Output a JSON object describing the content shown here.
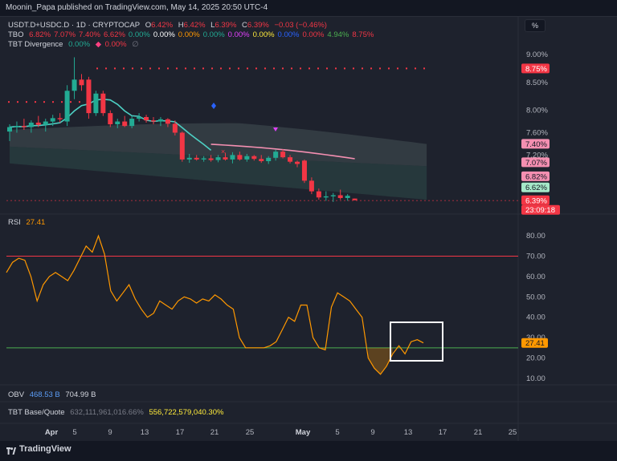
{
  "header": {
    "publisher_line": "Moonin_Papa published on TradingView.com, May 14, 2025 20:50 UTC-4"
  },
  "legend_main": {
    "symbol": "USDT.D+USDC.D · 1D · CRYPTOCAP",
    "o_label": "O",
    "o_value": "6.42%",
    "h_label": "H",
    "h_value": "6.42%",
    "l_label": "L",
    "l_value": "6.39%",
    "c_label": "C",
    "c_value": "6.39%",
    "change": "−0.03 (−0.46%)"
  },
  "legend_tbo": {
    "name": "TBO",
    "values": [
      "6.82%",
      "7.07%",
      "7.40%",
      "6.62%",
      "0.00%",
      "0.00%",
      "0.00%",
      "0.00%",
      "0.00%",
      "0.00%",
      "0.00%",
      "0.00%",
      "4.94%",
      "8.75%"
    ],
    "colors": [
      "#f23645",
      "#f23645",
      "#f23645",
      "#f23645",
      "#22ab94",
      "#ffffff",
      "#ff9800",
      "#22ab94",
      "#e040fb",
      "#ffeb3b",
      "#2962ff",
      "#f23645",
      "#4caf50",
      "#f23645"
    ]
  },
  "legend_div": {
    "name": "TBT Divergence",
    "v1": "0.00%",
    "v2": "0.00%",
    "v3": "∅"
  },
  "pct_button": "%",
  "rsi_legend": {
    "name": "RSI",
    "value": "27.41"
  },
  "obv_legend": {
    "name": "OBV",
    "v1": "468.53 B",
    "v2": "704.99 B"
  },
  "tbt_legend": {
    "name": "TBT Base/Quote",
    "v1": "632,111,961,016.66%",
    "v2": "556,722,579,040.30%"
  },
  "footer": {
    "brand": "TradingView"
  },
  "colors": {
    "up": "#22ab94",
    "down": "#f23645",
    "rsi": "#ff9800",
    "ma_fast": "#4dd0c4",
    "ma_slow": "#f48fb1",
    "overbought": "#f23645",
    "oversold": "#4caf50"
  },
  "chart_data": [
    {
      "type": "candlestick",
      "title": "USDT.D+USDC.D · 1D · CRYPTOCAP",
      "x_ticks": [
        "Apr",
        "5",
        "9",
        "13",
        "17",
        "21",
        "25",
        "May",
        "5",
        "9",
        "13",
        "17",
        "21",
        "25"
      ],
      "y_ticks": [
        "9.00%",
        "8.50%",
        "8.00%",
        "7.60%",
        "7.20%",
        "6.80%"
      ],
      "ylim": [
        6.2,
        9.1
      ],
      "price_labels": [
        {
          "text": "8.75%",
          "value": 8.75,
          "color": "#f23645"
        },
        {
          "text": "7.40%",
          "value": 7.4,
          "color": "#f48fb1"
        },
        {
          "text": "7.07%",
          "value": 7.07,
          "color": "#f48fb1"
        },
        {
          "text": "6.82%",
          "value": 6.82,
          "color": "#f48fb1"
        },
        {
          "text": "6.62%",
          "value": 6.62,
          "color": "#a5e8c8"
        },
        {
          "text": "6.39%",
          "value": 6.39,
          "color": "#f23645"
        }
      ],
      "countdown": "23:09:18",
      "candles": [
        {
          "o": 7.62,
          "h": 7.75,
          "l": 7.45,
          "c": 7.7
        },
        {
          "o": 7.7,
          "h": 7.8,
          "l": 7.6,
          "c": 7.72
        },
        {
          "o": 7.72,
          "h": 7.85,
          "l": 7.65,
          "c": 7.7
        },
        {
          "o": 7.7,
          "h": 7.82,
          "l": 7.6,
          "c": 7.78
        },
        {
          "o": 7.78,
          "h": 7.9,
          "l": 7.7,
          "c": 7.74
        },
        {
          "o": 7.74,
          "h": 7.85,
          "l": 7.62,
          "c": 7.8
        },
        {
          "o": 7.8,
          "h": 7.92,
          "l": 7.72,
          "c": 7.86
        },
        {
          "o": 7.86,
          "h": 7.95,
          "l": 7.78,
          "c": 7.84
        },
        {
          "o": 7.8,
          "h": 8.45,
          "l": 7.72,
          "c": 8.35
        },
        {
          "o": 8.35,
          "h": 8.95,
          "l": 8.2,
          "c": 8.55
        },
        {
          "o": 8.55,
          "h": 8.65,
          "l": 8.35,
          "c": 8.45
        },
        {
          "o": 8.55,
          "h": 8.6,
          "l": 7.85,
          "c": 7.95
        },
        {
          "o": 7.95,
          "h": 8.35,
          "l": 7.9,
          "c": 8.3
        },
        {
          "o": 8.3,
          "h": 8.35,
          "l": 7.9,
          "c": 7.95
        },
        {
          "o": 7.95,
          "h": 8.0,
          "l": 7.7,
          "c": 7.75
        },
        {
          "o": 7.75,
          "h": 7.85,
          "l": 7.68,
          "c": 7.8
        },
        {
          "o": 7.8,
          "h": 7.9,
          "l": 7.7,
          "c": 7.72
        },
        {
          "o": 7.72,
          "h": 7.9,
          "l": 7.68,
          "c": 7.85
        },
        {
          "o": 7.85,
          "h": 7.95,
          "l": 7.8,
          "c": 7.88
        },
        {
          "o": 7.88,
          "h": 7.92,
          "l": 7.78,
          "c": 7.82
        },
        {
          "o": 7.82,
          "h": 7.88,
          "l": 7.75,
          "c": 7.8
        },
        {
          "o": 7.8,
          "h": 7.88,
          "l": 7.72,
          "c": 7.84
        },
        {
          "o": 7.84,
          "h": 7.86,
          "l": 7.7,
          "c": 7.76
        },
        {
          "o": 7.76,
          "h": 7.82,
          "l": 7.55,
          "c": 7.6
        },
        {
          "o": 7.6,
          "h": 7.62,
          "l": 7.08,
          "c": 7.12
        },
        {
          "o": 7.12,
          "h": 7.22,
          "l": 7.06,
          "c": 7.15
        },
        {
          "o": 7.15,
          "h": 7.2,
          "l": 7.1,
          "c": 7.12
        },
        {
          "o": 7.12,
          "h": 7.18,
          "l": 7.08,
          "c": 7.14
        },
        {
          "o": 7.14,
          "h": 7.2,
          "l": 7.08,
          "c": 7.11
        },
        {
          "o": 7.11,
          "h": 7.2,
          "l": 7.07,
          "c": 7.16
        },
        {
          "o": 7.16,
          "h": 7.24,
          "l": 7.1,
          "c": 7.12
        },
        {
          "o": 7.12,
          "h": 7.25,
          "l": 7.05,
          "c": 7.2
        },
        {
          "o": 7.2,
          "h": 7.26,
          "l": 7.1,
          "c": 7.12
        },
        {
          "o": 7.12,
          "h": 7.22,
          "l": 7.08,
          "c": 7.18
        },
        {
          "o": 7.18,
          "h": 7.2,
          "l": 7.1,
          "c": 7.13
        },
        {
          "o": 7.13,
          "h": 7.2,
          "l": 7.06,
          "c": 7.09
        },
        {
          "o": 7.09,
          "h": 7.18,
          "l": 7.04,
          "c": 7.15
        },
        {
          "o": 7.15,
          "h": 7.3,
          "l": 7.1,
          "c": 7.26
        },
        {
          "o": 7.26,
          "h": 7.3,
          "l": 7.14,
          "c": 7.16
        },
        {
          "o": 7.16,
          "h": 7.2,
          "l": 7.05,
          "c": 7.08
        },
        {
          "o": 7.08,
          "h": 7.1,
          "l": 6.98,
          "c": 7.04
        },
        {
          "o": 7.1,
          "h": 7.12,
          "l": 6.7,
          "c": 6.74
        },
        {
          "o": 6.74,
          "h": 6.8,
          "l": 6.5,
          "c": 6.55
        },
        {
          "o": 6.55,
          "h": 6.6,
          "l": 6.4,
          "c": 6.44
        },
        {
          "o": 6.44,
          "h": 6.55,
          "l": 6.38,
          "c": 6.46
        },
        {
          "o": 6.46,
          "h": 6.52,
          "l": 6.36,
          "c": 6.48
        },
        {
          "o": 6.48,
          "h": 6.58,
          "l": 6.4,
          "c": 6.43
        },
        {
          "o": 6.43,
          "h": 6.5,
          "l": 6.38,
          "c": 6.47
        },
        {
          "o": 6.42,
          "h": 6.42,
          "l": 6.39,
          "c": 6.39
        }
      ],
      "resistance_level": 8.75,
      "support_level": 7.75
    },
    {
      "type": "line",
      "title": "RSI",
      "y_ticks": [
        "80.00",
        "70.00",
        "60.00",
        "50.00",
        "40.00",
        "30.00",
        "20.00",
        "10.00"
      ],
      "ylim": [
        8,
        84
      ],
      "overbought": 70,
      "oversold": 25,
      "current_label": "27.41",
      "values": [
        62,
        67,
        69,
        68,
        60,
        48,
        56,
        60,
        62,
        60,
        58,
        63,
        69,
        75,
        72,
        80,
        71,
        53,
        48,
        52,
        56,
        49,
        44,
        40,
        42,
        48,
        46,
        44,
        48,
        50,
        49,
        47,
        49,
        48,
        51,
        49,
        46,
        44,
        30,
        25,
        25,
        25,
        25,
        26,
        28,
        34,
        40,
        38,
        46,
        46,
        30,
        25,
        24,
        45,
        52,
        50,
        48,
        44,
        40,
        20,
        15,
        12,
        16,
        22,
        26,
        22,
        28,
        29,
        27.41
      ]
    }
  ]
}
